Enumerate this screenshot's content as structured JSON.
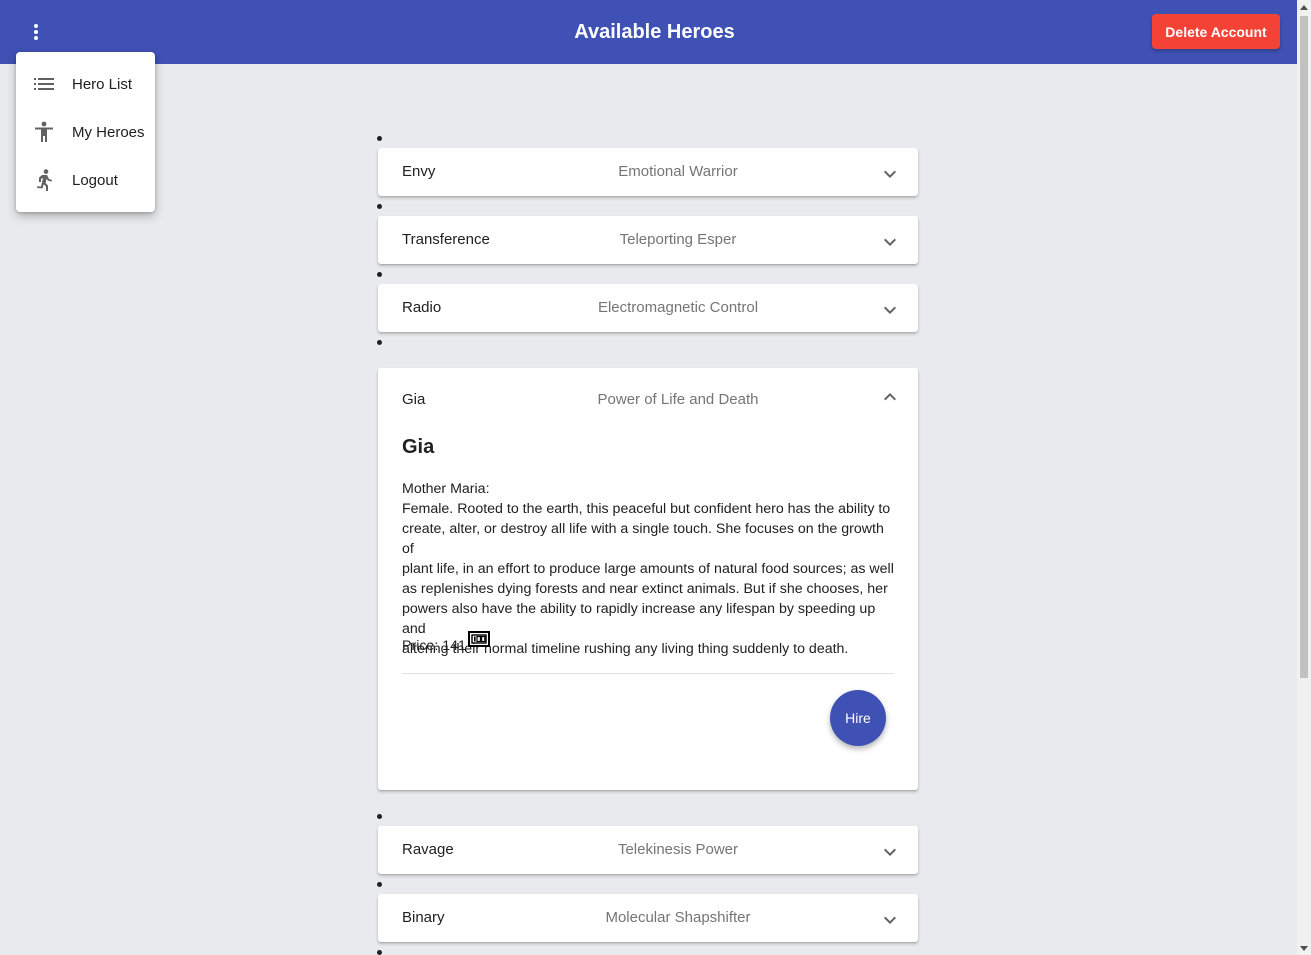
{
  "header": {
    "title": "Available Heroes",
    "delete_label": "Delete Account",
    "menu_icon": "more-vert-icon"
  },
  "menu": {
    "items": [
      {
        "label": "Hero List",
        "icon": "list-icon"
      },
      {
        "label": "My Heroes",
        "icon": "accessibility-icon"
      },
      {
        "label": "Logout",
        "icon": "running-person-icon"
      }
    ]
  },
  "heroes": [
    {
      "name": "Envy",
      "power": "Emotional Warrior",
      "expanded": false
    },
    {
      "name": "Transference",
      "power": "Teleporting Esper",
      "expanded": false
    },
    {
      "name": "Radio",
      "power": "Electromagnetic Control",
      "expanded": false
    },
    {
      "name": "Gia",
      "power": "Power of Life and Death",
      "expanded": true
    },
    {
      "name": "Ravage",
      "power": "Telekinesis Power",
      "expanded": false
    },
    {
      "name": "Binary",
      "power": "Molecular Shapshifter",
      "expanded": false
    }
  ],
  "detail": {
    "name": "Gia",
    "alias": "Mother Maria:",
    "description_lines": [
      "Female. Rooted to the earth, this peaceful but confident hero has the ability to",
      "create, alter, or destroy all life with a single touch. She focuses on the growth of",
      "plant life, in an effort to produce large amounts of natural food sources; as well",
      "as replenishes dying forests and near extinct animals. But if she chooses, her",
      "powers also have the ability to rapidly increase any lifespan by speeding up and",
      "altering their normal timeline rushing any living thing suddenly to death."
    ],
    "price_label": "Price: 141",
    "price_icon": "money-icon",
    "hire_label": "Hire"
  },
  "colors": {
    "primary": "#3f51b5",
    "warn": "#f44336",
    "background": "#e8eaed"
  }
}
